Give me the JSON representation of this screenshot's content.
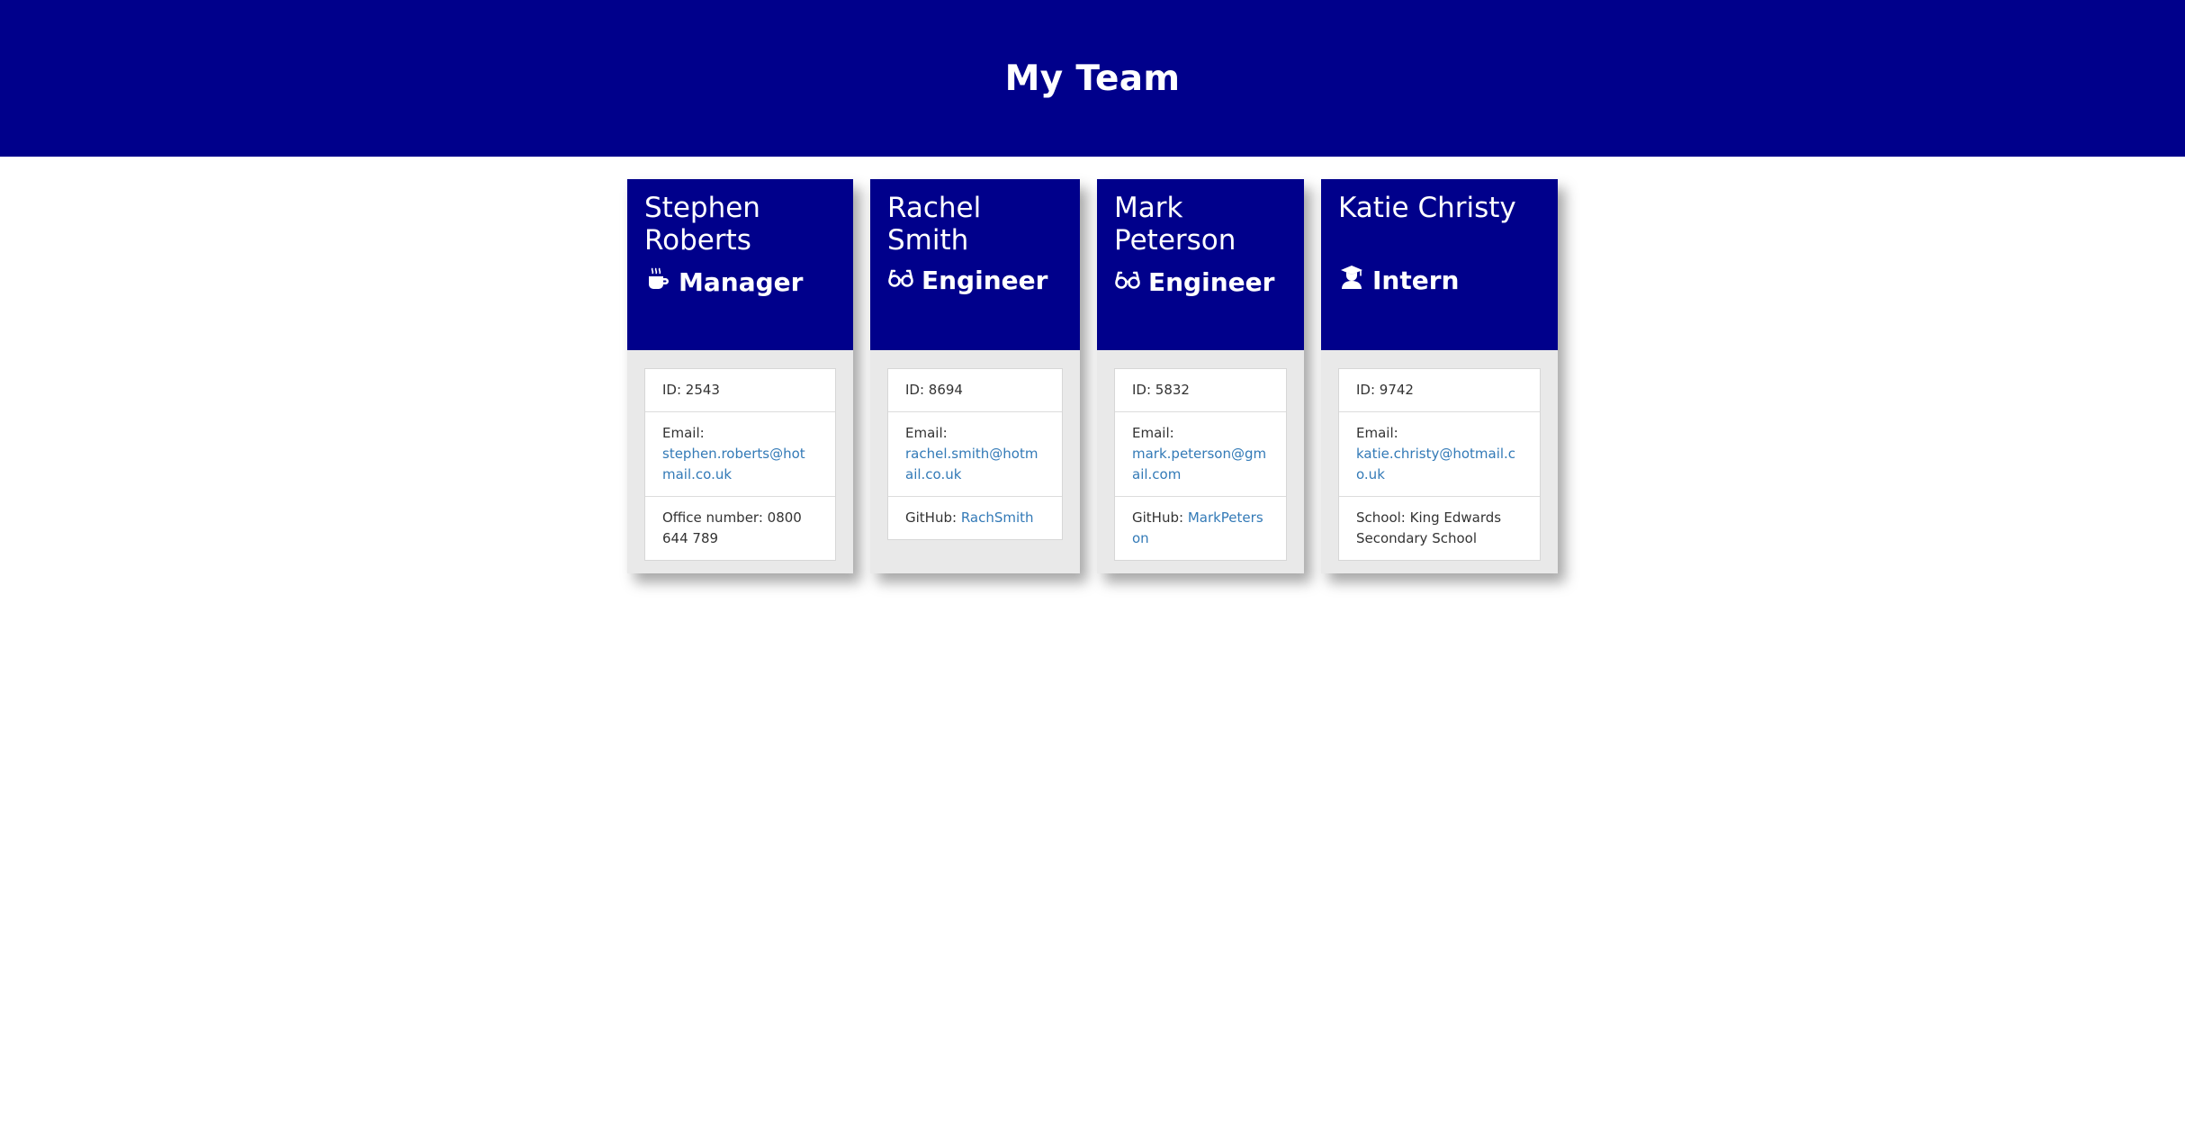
{
  "header": {
    "title": "My Team"
  },
  "colors": {
    "header_bg": "#00008b",
    "card_body_bg": "#e9e9e9",
    "link": "#337ab7"
  },
  "team": [
    {
      "name": "Stephen Roberts",
      "role": "Manager",
      "role_icon": "mug-icon",
      "id_text": "ID: 2543",
      "email_label": "Email:",
      "email": "stephen.roberts@hotmail.co.uk",
      "extra_label": "Office number: 0800 644 789",
      "extra_link": ""
    },
    {
      "name": "Rachel Smith",
      "role": "Engineer",
      "role_icon": "glasses-icon",
      "id_text": "ID: 8694",
      "email_label": "Email:",
      "email": "rachel.smith@hotmail.co.uk",
      "extra_label": "GitHub: ",
      "extra_link": "RachSmith"
    },
    {
      "name": "Mark Peterson",
      "role": "Engineer",
      "role_icon": "glasses-icon",
      "id_text": "ID: 5832",
      "email_label": "Email:",
      "email": "mark.peterson@gmail.com",
      "extra_label": "GitHub: ",
      "extra_link": "MarkPeterson"
    },
    {
      "name": "Katie Christy",
      "role": "Intern",
      "role_icon": "graduate-icon",
      "id_text": "ID: 9742",
      "email_label": "Email:",
      "email": "katie.christy@hotmail.co.uk",
      "extra_label": "School: King Edwards Secondary School",
      "extra_link": ""
    }
  ]
}
